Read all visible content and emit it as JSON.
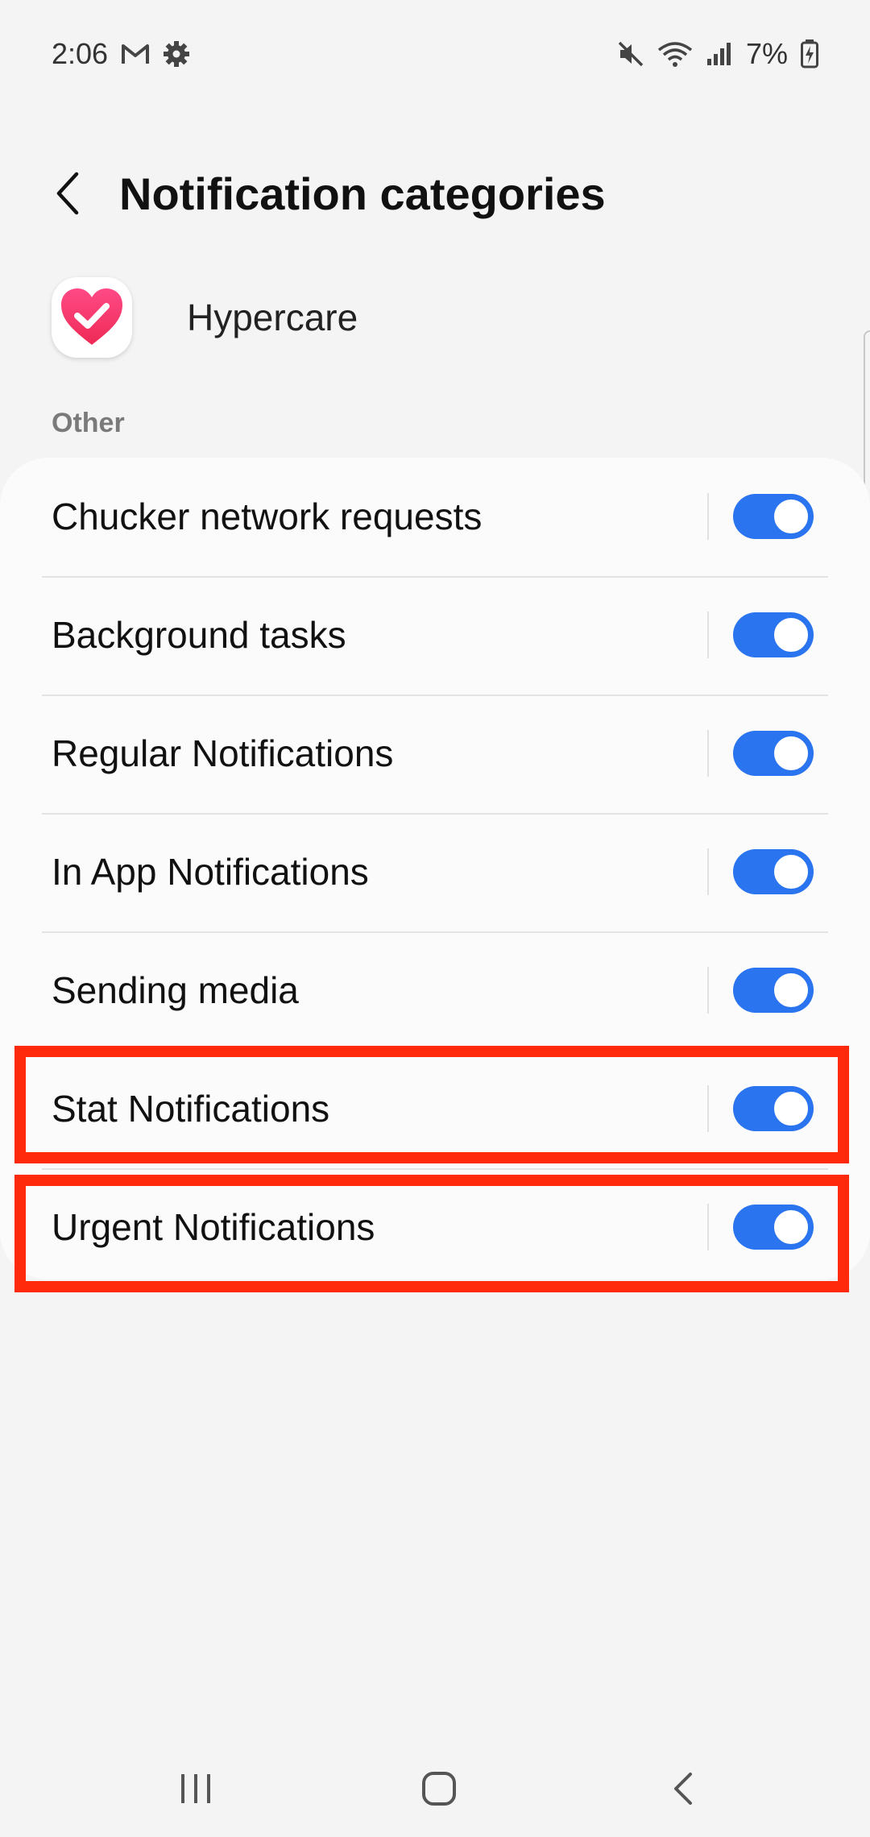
{
  "status_bar": {
    "time": "2:06",
    "battery": "7%",
    "icons": [
      "gmail-icon",
      "settings-gear-icon",
      "mute-icon",
      "wifi-icon",
      "signal-icon",
      "battery-charging-icon"
    ]
  },
  "header": {
    "title": "Notification categories",
    "back_icon": "chevron-left-icon"
  },
  "app": {
    "name": "Hypercare",
    "icon": "heart-check-icon"
  },
  "section": {
    "label": "Other"
  },
  "categories": [
    {
      "label": "Chucker network requests",
      "enabled": true
    },
    {
      "label": "Background tasks",
      "enabled": true
    },
    {
      "label": "Regular Notifications",
      "enabled": true
    },
    {
      "label": "In App Notifications",
      "enabled": true
    },
    {
      "label": "Sending media",
      "enabled": true
    },
    {
      "label": "Stat Notifications",
      "enabled": true,
      "highlighted": true
    },
    {
      "label": "Urgent Notifications",
      "enabled": true,
      "highlighted": true
    }
  ],
  "colors": {
    "accent": "#2a74f0",
    "highlight": "#ff2a0c",
    "background": "#f4f4f4"
  },
  "nav_bar": {
    "icons": [
      "recent-apps-icon",
      "home-icon",
      "back-icon"
    ]
  }
}
